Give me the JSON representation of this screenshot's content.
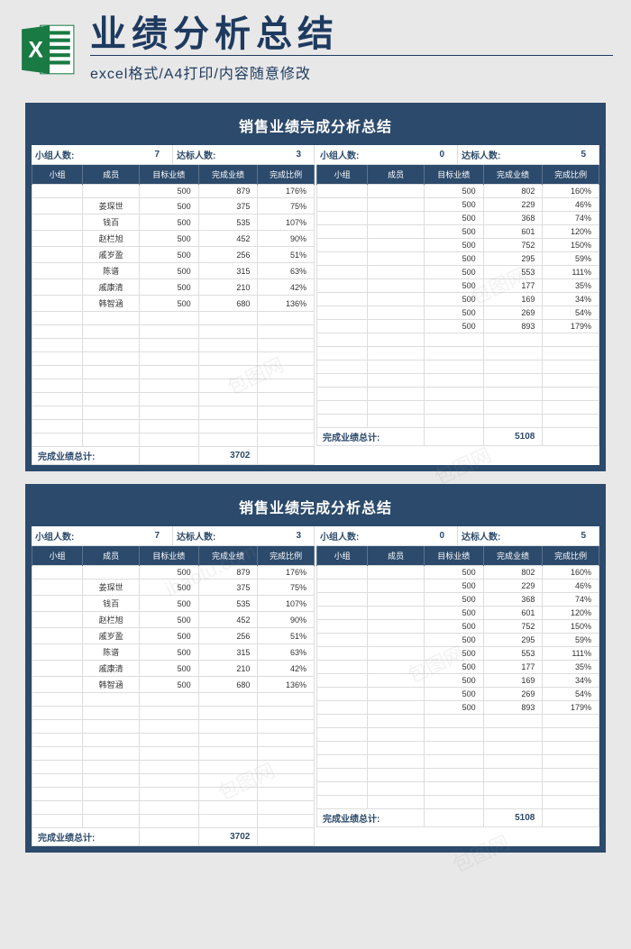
{
  "header": {
    "title": "业绩分析总结",
    "subtitle": "excel格式/A4打印/内容随意修改"
  },
  "icon": {
    "letter": "X"
  },
  "sheet_title": "销售业绩完成分析总结",
  "col_headers": [
    "小组",
    "成员",
    "目标业绩",
    "完成业绩",
    "完成比例"
  ],
  "stats_labels": {
    "group_count": "小组人数:",
    "standard_count": "达标人数:"
  },
  "total_label": "完成业绩总计:",
  "sheets": [
    {
      "left": {
        "group_count": "7",
        "standard_count": "3",
        "rows": [
          [
            "",
            "",
            "500",
            "879",
            "176%"
          ],
          [
            "",
            "姜琛世",
            "500",
            "375",
            "75%"
          ],
          [
            "",
            "钱百",
            "500",
            "535",
            "107%"
          ],
          [
            "",
            "赵栏旭",
            "500",
            "452",
            "90%"
          ],
          [
            "",
            "戚岁盈",
            "500",
            "256",
            "51%"
          ],
          [
            "",
            "陈谱",
            "500",
            "315",
            "63%"
          ],
          [
            "",
            "戚康清",
            "500",
            "210",
            "42%"
          ],
          [
            "",
            "韩智涵",
            "500",
            "680",
            "136%"
          ],
          [
            "",
            "",
            "",
            "",
            ""
          ],
          [
            "",
            "",
            "",
            "",
            ""
          ],
          [
            "",
            "",
            "",
            "",
            ""
          ],
          [
            "",
            "",
            "",
            "",
            ""
          ],
          [
            "",
            "",
            "",
            "",
            ""
          ],
          [
            "",
            "",
            "",
            "",
            ""
          ],
          [
            "",
            "",
            "",
            "",
            ""
          ],
          [
            "",
            "",
            "",
            "",
            ""
          ],
          [
            "",
            "",
            "",
            "",
            ""
          ],
          [
            "",
            "",
            "",
            "",
            ""
          ]
        ],
        "total": "3702"
      },
      "right": {
        "group_count": "0",
        "standard_count": "5",
        "rows": [
          [
            "",
            "",
            "500",
            "802",
            "160%"
          ],
          [
            "",
            "",
            "500",
            "229",
            "46%"
          ],
          [
            "",
            "",
            "500",
            "368",
            "74%"
          ],
          [
            "",
            "",
            "500",
            "601",
            "120%"
          ],
          [
            "",
            "",
            "500",
            "752",
            "150%"
          ],
          [
            "",
            "",
            "500",
            "295",
            "59%"
          ],
          [
            "",
            "",
            "500",
            "553",
            "111%"
          ],
          [
            "",
            "",
            "500",
            "177",
            "35%"
          ],
          [
            "",
            "",
            "500",
            "169",
            "34%"
          ],
          [
            "",
            "",
            "500",
            "269",
            "54%"
          ],
          [
            "",
            "",
            "500",
            "893",
            "179%"
          ],
          [
            "",
            "",
            "",
            "",
            ""
          ],
          [
            "",
            "",
            "",
            "",
            ""
          ],
          [
            "",
            "",
            "",
            "",
            ""
          ],
          [
            "",
            "",
            "",
            "",
            ""
          ],
          [
            "",
            "",
            "",
            "",
            ""
          ],
          [
            "",
            "",
            "",
            "",
            ""
          ],
          [
            "",
            "",
            "",
            "",
            ""
          ]
        ],
        "total": "5108"
      }
    },
    {
      "left": {
        "group_count": "7",
        "standard_count": "3",
        "rows": [
          [
            "",
            "",
            "500",
            "879",
            "176%"
          ],
          [
            "",
            "姜琛世",
            "500",
            "375",
            "75%"
          ],
          [
            "",
            "钱百",
            "500",
            "535",
            "107%"
          ],
          [
            "",
            "赵栏旭",
            "500",
            "452",
            "90%"
          ],
          [
            "",
            "戚岁盈",
            "500",
            "256",
            "51%"
          ],
          [
            "",
            "陈谱",
            "500",
            "315",
            "63%"
          ],
          [
            "",
            "戚康清",
            "500",
            "210",
            "42%"
          ],
          [
            "",
            "韩智涵",
            "500",
            "680",
            "136%"
          ],
          [
            "",
            "",
            "",
            "",
            ""
          ],
          [
            "",
            "",
            "",
            "",
            ""
          ],
          [
            "",
            "",
            "",
            "",
            ""
          ],
          [
            "",
            "",
            "",
            "",
            ""
          ],
          [
            "",
            "",
            "",
            "",
            ""
          ],
          [
            "",
            "",
            "",
            "",
            ""
          ],
          [
            "",
            "",
            "",
            "",
            ""
          ],
          [
            "",
            "",
            "",
            "",
            ""
          ],
          [
            "",
            "",
            "",
            "",
            ""
          ],
          [
            "",
            "",
            "",
            "",
            ""
          ]
        ],
        "total": "3702"
      },
      "right": {
        "group_count": "0",
        "standard_count": "5",
        "rows": [
          [
            "",
            "",
            "500",
            "802",
            "160%"
          ],
          [
            "",
            "",
            "500",
            "229",
            "46%"
          ],
          [
            "",
            "",
            "500",
            "368",
            "74%"
          ],
          [
            "",
            "",
            "500",
            "601",
            "120%"
          ],
          [
            "",
            "",
            "500",
            "752",
            "150%"
          ],
          [
            "",
            "",
            "500",
            "295",
            "59%"
          ],
          [
            "",
            "",
            "500",
            "553",
            "111%"
          ],
          [
            "",
            "",
            "500",
            "177",
            "35%"
          ],
          [
            "",
            "",
            "500",
            "169",
            "34%"
          ],
          [
            "",
            "",
            "500",
            "269",
            "54%"
          ],
          [
            "",
            "",
            "500",
            "893",
            "179%"
          ],
          [
            "",
            "",
            "",
            "",
            ""
          ],
          [
            "",
            "",
            "",
            "",
            ""
          ],
          [
            "",
            "",
            "",
            "",
            ""
          ],
          [
            "",
            "",
            "",
            "",
            ""
          ],
          [
            "",
            "",
            "",
            "",
            ""
          ],
          [
            "",
            "",
            "",
            "",
            ""
          ],
          [
            "",
            "",
            "",
            "",
            ""
          ]
        ],
        "total": "5108"
      }
    }
  ]
}
